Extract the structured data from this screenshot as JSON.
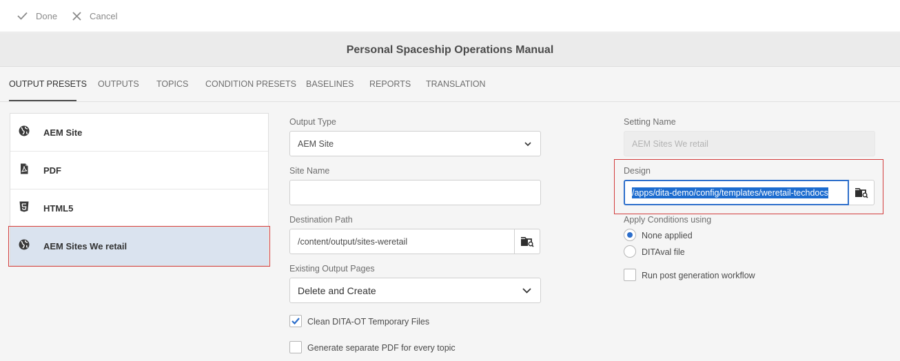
{
  "actions": {
    "done": "Done",
    "cancel": "Cancel"
  },
  "title": "Personal Spaceship Operations Manual",
  "tabs": [
    {
      "label": "OUTPUT PRESETS",
      "active": true
    },
    {
      "label": "OUTPUTS"
    },
    {
      "label": "TOPICS"
    },
    {
      "label": "CONDITION PRESETS"
    },
    {
      "label": "BASELINES"
    },
    {
      "label": "REPORTS"
    },
    {
      "label": "TRANSLATION"
    }
  ],
  "presets": [
    {
      "label": "AEM Site",
      "icon": "globe-icon"
    },
    {
      "label": "PDF",
      "icon": "pdf-file-icon"
    },
    {
      "label": "HTML5",
      "icon": "html5-icon"
    },
    {
      "label": "AEM Sites We retail",
      "icon": "globe-icon",
      "selected": true
    }
  ],
  "form": {
    "output_type": {
      "label": "Output Type",
      "value": "AEM Site"
    },
    "site_name": {
      "label": "Site Name",
      "value": ""
    },
    "destination_path": {
      "label": "Destination Path",
      "value": "/content/output/sites-weretail"
    },
    "existing_pages": {
      "label": "Existing Output Pages",
      "value": "Delete and Create"
    },
    "clean_temp": {
      "label": "Clean DITA-OT Temporary Files",
      "checked": true
    },
    "separate_pdf": {
      "label": "Generate separate PDF for every topic",
      "checked": false
    },
    "setting_name": {
      "label": "Setting Name",
      "value": "AEM Sites We retail"
    },
    "design": {
      "label": "Design",
      "value": "/apps/dita-demo/config/templates/weretail-techdocs"
    },
    "apply_conditions": {
      "label": "Apply Conditions using",
      "options": [
        "None applied",
        "DITAval file"
      ],
      "selected": "None applied"
    },
    "post_workflow": {
      "label": "Run post generation workflow",
      "checked": false
    }
  },
  "colors": {
    "accent": "#2c6ecb",
    "highlight": "#1c6ccf",
    "selected_row": "#dae3ef",
    "annotation_red": "#d23b3b"
  }
}
